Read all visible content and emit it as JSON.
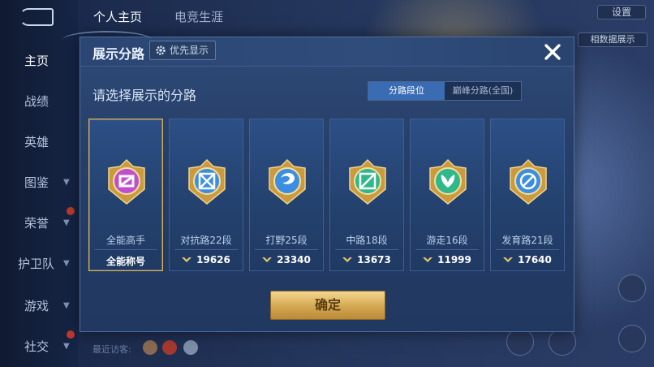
{
  "background": {
    "nav": [
      {
        "label": "主页",
        "active": true
      },
      {
        "label": "战绩"
      },
      {
        "label": "英雄"
      },
      {
        "label": "图鉴",
        "chevron": true
      },
      {
        "label": "荣誉",
        "chevron": true
      },
      {
        "label": "护卫队",
        "chevron": true
      },
      {
        "label": "游戏",
        "chevron": true
      },
      {
        "label": "社交",
        "chevron": true
      }
    ],
    "top_tabs": [
      "个人主页",
      "电竞生涯"
    ],
    "top_right_chip": "设置",
    "header_chip": "相数据展示",
    "recent_visitors": "最近访客:"
  },
  "modal": {
    "title": "展示分路",
    "priority_label": "优先显示",
    "subtitle": "请选择展示的分路",
    "toggle": [
      "分路段位",
      "巅峰分路(全国)"
    ],
    "toggle_selected": 0,
    "cards": [
      {
        "rank": "全能高手",
        "score": "全能称号",
        "icon": "all-round-emblem-icon",
        "color": "#c04fd0",
        "selected": true,
        "show_score_icon": false
      },
      {
        "rank": "对抗路22段",
        "score": "19626",
        "icon": "clash-lane-emblem-icon",
        "color": "#3c8ee0",
        "selected": false,
        "show_score_icon": true
      },
      {
        "rank": "打野25段",
        "score": "23340",
        "icon": "jungle-emblem-icon",
        "color": "#3c8ee0",
        "selected": false,
        "show_score_icon": true
      },
      {
        "rank": "中路18段",
        "score": "13673",
        "icon": "mid-lane-emblem-icon",
        "color": "#2fb88a",
        "selected": false,
        "show_score_icon": true
      },
      {
        "rank": "游走16段",
        "score": "11999",
        "icon": "roam-emblem-icon",
        "color": "#2fb88a",
        "selected": false,
        "show_score_icon": true
      },
      {
        "rank": "发育路21段",
        "score": "17640",
        "icon": "farm-lane-emblem-icon",
        "color": "#3c8ee0",
        "selected": false,
        "show_score_icon": true
      }
    ],
    "confirm_label": "确定"
  }
}
